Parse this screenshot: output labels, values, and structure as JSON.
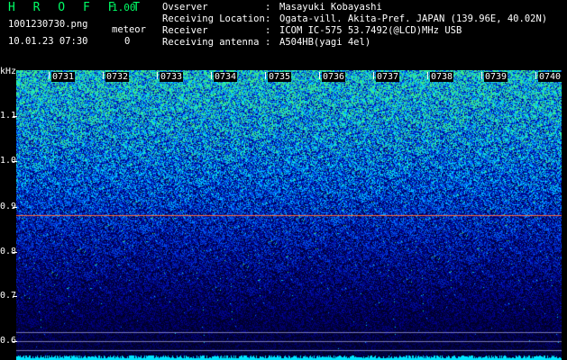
{
  "header": {
    "brand": "H R O F F T",
    "version": "1.00",
    "filename": "1001230730.png",
    "datetime": "10.01.23 07:30",
    "meteor_label": "meteor",
    "meteor_count": "0"
  },
  "station": {
    "rows": [
      {
        "key": "Ovserver",
        "value": "Masayuki Kobayashi"
      },
      {
        "key": "Receiving Location",
        "value": "Ogata-vill. Akita-Pref. JAPAN (139.96E, 40.02N)"
      },
      {
        "key": "Receiver",
        "value": "ICOM IC-575 53.7492(@LCD)MHz USB"
      },
      {
        "key": "Receiving antenna",
        "value": "A504HB(yagi 4el)"
      }
    ],
    "separator": ":"
  },
  "axis": {
    "unit": "kHz",
    "freq_labels": [
      "1.1",
      "1.0",
      "0.9",
      "0.8",
      "0.7",
      "0.6"
    ],
    "time_labels": [
      "0731",
      "0732",
      "0733",
      "0734",
      "0735",
      "0736",
      "0737",
      "0738",
      "0739",
      "0740"
    ]
  },
  "colors": {
    "brand": "#00ff66",
    "reference_line": "#ff6a3d",
    "baseline": "#00e5ff"
  }
}
